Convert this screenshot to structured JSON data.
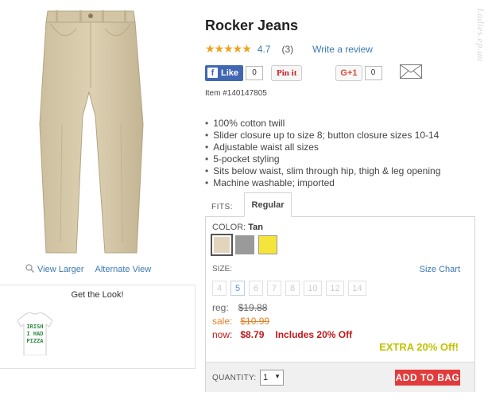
{
  "product": {
    "title": "Rocker Jeans",
    "rating": "4.7",
    "review_count": "(3)",
    "write_review": "Write a review",
    "item_number": "Item #140147805",
    "features": [
      "100% cotton twill",
      "Slider closure up to size 8; button closure sizes 10-14",
      "Adjustable waist all sizes",
      "5-pocket styling",
      "Sits below waist, slim through hip, thigh & leg opening",
      "Machine washable; imported"
    ]
  },
  "social": {
    "like_label": "Like",
    "like_count": "0",
    "pin_label": "Pin it",
    "gplus_label": "G+1",
    "gplus_count": "0"
  },
  "gallery": {
    "view_larger": "View Larger",
    "alternate_view": "Alternate View",
    "get_the_look": "Get the Look!",
    "tshirt_text": [
      "IRISH",
      "I HAD",
      "PIZZA"
    ]
  },
  "fits": {
    "label": "FITS:",
    "selected_tab": "Regular"
  },
  "color": {
    "label": "COLOR:",
    "selected": "Tan",
    "swatches": [
      "#e3d5bd",
      "#9a9a9a",
      "#f5e43a"
    ]
  },
  "size": {
    "label": "SIZE:",
    "chart_link": "Size Chart",
    "options": [
      "4",
      "5",
      "6",
      "7",
      "8",
      "10",
      "12",
      "14"
    ],
    "available": [
      "5"
    ]
  },
  "pricing": {
    "reg_label": "reg:",
    "reg_value": "$19.88",
    "sale_label": "sale:",
    "sale_value": "$10.99",
    "now_label": "now:",
    "now_value": "$8.79",
    "now_note": "Includes 20% Off",
    "extra_off": "EXTRA 20% Off!"
  },
  "purchase": {
    "quantity_label": "QUANTITY:",
    "quantity_value": "1",
    "add_to_bag": "ADD TO BAG"
  },
  "watermark": "Ladies.ep.ua"
}
